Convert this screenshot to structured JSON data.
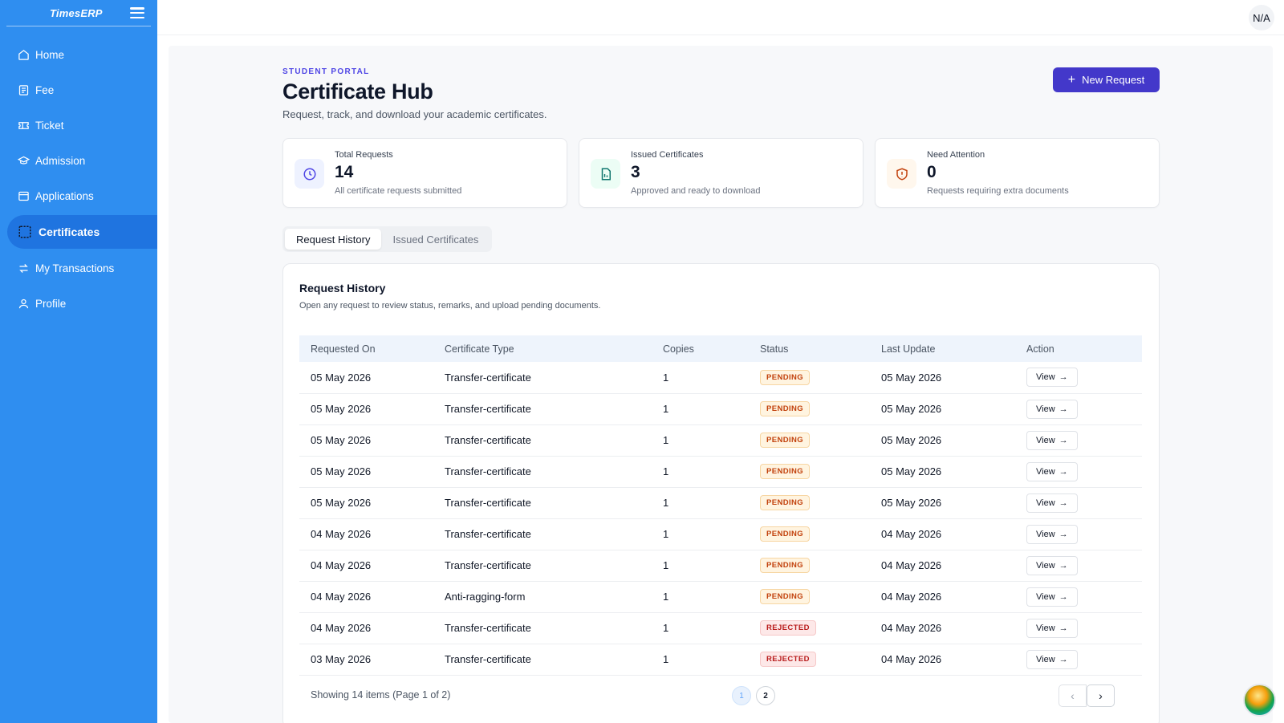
{
  "brand": {
    "name": "TimesERP"
  },
  "sidebar": {
    "items": [
      {
        "label": "Home",
        "icon": "home-icon"
      },
      {
        "label": "Fee",
        "icon": "fee-icon"
      },
      {
        "label": "Ticket",
        "icon": "ticket-icon"
      },
      {
        "label": "Admission",
        "icon": "graduation-cap-icon"
      },
      {
        "label": "Applications",
        "icon": "window-icon"
      },
      {
        "label": "Certificates",
        "icon": "certificate-icon",
        "active": true
      },
      {
        "label": "My Transactions",
        "icon": "transfer-arrows-icon"
      },
      {
        "label": "Profile",
        "icon": "user-icon"
      }
    ]
  },
  "topbar": {
    "avatar_text": "N/A"
  },
  "page": {
    "eyebrow": "STUDENT PORTAL",
    "title": "Certificate Hub",
    "subtitle": "Request, track, and download your academic certificates.",
    "new_request_label": "New Request"
  },
  "stats": [
    {
      "label": "Total Requests",
      "value": "14",
      "desc": "All certificate requests submitted",
      "icon": "clock-icon",
      "color": "#4f46e5"
    },
    {
      "label": "Issued Certificates",
      "value": "3",
      "desc": "Approved and ready to download",
      "icon": "document-icon",
      "color": "#0f766e"
    },
    {
      "label": "Need Attention",
      "value": "0",
      "desc": "Requests requiring extra documents",
      "icon": "shield-alert-icon",
      "color": "#c2410c"
    }
  ],
  "tabs": [
    {
      "label": "Request History",
      "active": true
    },
    {
      "label": "Issued Certificates",
      "active": false
    }
  ],
  "history": {
    "title": "Request History",
    "desc": "Open any request to review status, remarks, and upload pending documents.",
    "columns": [
      "Requested On",
      "Certificate Type",
      "Copies",
      "Status",
      "Last Update",
      "Action"
    ],
    "rows": [
      {
        "requested": "05 May 2026",
        "type": "Transfer-certificate",
        "copies": "1",
        "status": "PENDING",
        "updated": "05 May 2026",
        "action": "View"
      },
      {
        "requested": "05 May 2026",
        "type": "Transfer-certificate",
        "copies": "1",
        "status": "PENDING",
        "updated": "05 May 2026",
        "action": "View"
      },
      {
        "requested": "05 May 2026",
        "type": "Transfer-certificate",
        "copies": "1",
        "status": "PENDING",
        "updated": "05 May 2026",
        "action": "View"
      },
      {
        "requested": "05 May 2026",
        "type": "Transfer-certificate",
        "copies": "1",
        "status": "PENDING",
        "updated": "05 May 2026",
        "action": "View"
      },
      {
        "requested": "05 May 2026",
        "type": "Transfer-certificate",
        "copies": "1",
        "status": "PENDING",
        "updated": "05 May 2026",
        "action": "View"
      },
      {
        "requested": "04 May 2026",
        "type": "Transfer-certificate",
        "copies": "1",
        "status": "PENDING",
        "updated": "04 May 2026",
        "action": "View"
      },
      {
        "requested": "04 May 2026",
        "type": "Transfer-certificate",
        "copies": "1",
        "status": "PENDING",
        "updated": "04 May 2026",
        "action": "View"
      },
      {
        "requested": "04 May 2026",
        "type": "Anti-ragging-form",
        "copies": "1",
        "status": "PENDING",
        "updated": "04 May 2026",
        "action": "View"
      },
      {
        "requested": "04 May 2026",
        "type": "Transfer-certificate",
        "copies": "1",
        "status": "REJECTED",
        "updated": "04 May 2026",
        "action": "View"
      },
      {
        "requested": "03 May 2026",
        "type": "Transfer-certificate",
        "copies": "1",
        "status": "REJECTED",
        "updated": "04 May 2026",
        "action": "View"
      }
    ],
    "footer": "Showing 14 items (Page 1 of 2)",
    "pages": [
      "1",
      "2"
    ],
    "current_page": "1"
  },
  "colors": {
    "sidebar": "#2f8ef0",
    "sidebar_active": "#1f74e0",
    "primary_button": "#4338ca",
    "eyebrow": "#4f46e5"
  }
}
